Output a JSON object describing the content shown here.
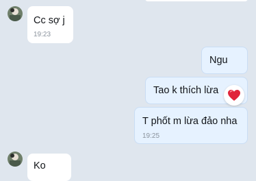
{
  "messages": [
    {
      "text": "Cc sợ j",
      "time": "19:23"
    },
    {
      "text": "Ngu"
    },
    {
      "text": "Tao k thích lừa"
    },
    {
      "text": "T phốt m lừa đảo nha",
      "time": "19:25"
    },
    {
      "text": "Ko"
    }
  ],
  "reaction_icon": "heart-icon",
  "colors": {
    "background": "#dfe6ee",
    "incoming_bubble": "#ffffff",
    "outgoing_bubble": "#e6f2ff",
    "heart": "#e0243a"
  }
}
